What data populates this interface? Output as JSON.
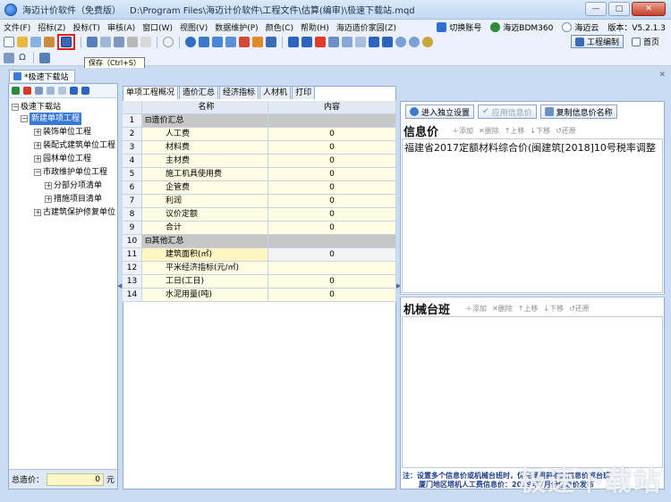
{
  "window": {
    "app_title": "海迈计价软件（免费版）",
    "file_path": "D:\\Program Files\\海迈计价软件\\工程文件\\估算(编审)\\极速下载站.mqd",
    "minimize": "—",
    "maximize": "□",
    "close": "✕"
  },
  "menu": {
    "items": [
      "文件(F)",
      "招标(Z)",
      "投标(T)",
      "审核(A)",
      "窗口(W)",
      "视图(V)",
      "数据维护(P)",
      "颜色(C)",
      "帮助(H)",
      "海迈造价家园(Z)"
    ],
    "switch_account": "切换账号",
    "bdm": "海迈BDM360",
    "cloud": "海迈云",
    "version": "版本：V5.2.1.3"
  },
  "toolbar": {
    "project_edit": "工程编制",
    "home": "首页"
  },
  "tooltip": "保存（Ctrl+S）",
  "document_tab": "*极速下载站",
  "tree": {
    "root": "极速下载站",
    "nodes": [
      {
        "label": "新建单项工程",
        "level": 1,
        "toggle": "−",
        "selected": true
      },
      {
        "label": "装饰单位工程",
        "level": 2,
        "toggle": "+"
      },
      {
        "label": "装配式建筑单位工程",
        "level": 2,
        "toggle": "+"
      },
      {
        "label": "园林单位工程",
        "level": 2,
        "toggle": "+"
      },
      {
        "label": "市政维护单位工程",
        "level": 2,
        "toggle": "−"
      },
      {
        "label": "分部分项清单",
        "level": 3,
        "toggle": "+"
      },
      {
        "label": "措施项目清单",
        "level": 3,
        "toggle": "+"
      },
      {
        "label": "古建筑保护修复单位",
        "level": 2,
        "toggle": "+"
      }
    ],
    "total_label": "总造价：",
    "total_value": "0",
    "total_unit": "元"
  },
  "center": {
    "tabs": [
      "单项工程概况",
      "造价汇总",
      "经济指标",
      "人材机",
      "打印"
    ],
    "columns": [
      "",
      "名称",
      "内容"
    ],
    "rows": [
      {
        "num": "1",
        "name": "造价汇总",
        "value": "",
        "type": "section"
      },
      {
        "num": "2",
        "name": "人工费",
        "value": "0",
        "type": "item"
      },
      {
        "num": "3",
        "name": "材料费",
        "value": "0",
        "type": "item"
      },
      {
        "num": "4",
        "name": "主材费",
        "value": "0",
        "type": "item"
      },
      {
        "num": "5",
        "name": "施工机具使用费",
        "value": "0",
        "type": "item"
      },
      {
        "num": "6",
        "name": "企管费",
        "value": "0",
        "type": "item"
      },
      {
        "num": "7",
        "name": "利润",
        "value": "0",
        "type": "item"
      },
      {
        "num": "8",
        "name": "议价定额",
        "value": "0",
        "type": "item"
      },
      {
        "num": "9",
        "name": "合计",
        "value": "0",
        "type": "item"
      },
      {
        "num": "10",
        "name": "其他汇总",
        "value": "",
        "type": "section"
      },
      {
        "num": "11",
        "name": "建筑面积(㎡)",
        "value": "0",
        "type": "item",
        "selected": true
      },
      {
        "num": "12",
        "name": "平米经济指标(元/㎡)",
        "value": "",
        "type": "item"
      },
      {
        "num": "13",
        "name": "工日(工日)",
        "value": "0",
        "type": "item"
      },
      {
        "num": "14",
        "name": "水泥用量(吨)",
        "value": "0",
        "type": "item"
      }
    ]
  },
  "right": {
    "btn_independent": "进入独立设置",
    "btn_apply": "应用信息价",
    "btn_copy_name": "复制信息价名称",
    "info_title": "信息价",
    "info_actions": [
      "添加",
      "删除",
      "上移",
      "下移",
      "还原"
    ],
    "info_text": "福建省2017定额材料综合价(闽建筑[2018]10号税率调整",
    "machine_title": "机械台班",
    "machine_actions": [
      "添加",
      "删除",
      "上移",
      "下移",
      "还原"
    ],
    "note_line1": "注：设置多个信息价或机械台班时，优先调用前面的信息价或台班",
    "note_line2": "厦门地区塔机人工费信息价：2019年7月份信息价发布"
  },
  "watermark": "极速下载站"
}
